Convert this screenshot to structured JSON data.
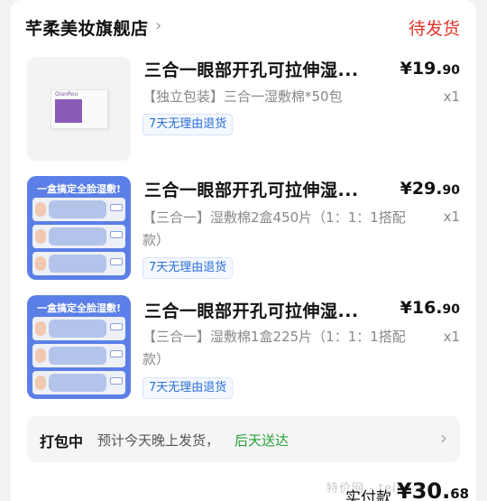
{
  "header": {
    "shop_name": "芊柔美妆旗舰店",
    "chevron": "›",
    "status": "待发货"
  },
  "items": [
    {
      "title": "三合一眼部开孔可拉伸湿...",
      "price_main": "¥19.",
      "price_cents": "90",
      "sku": "【独立包装】三合一湿敷棉*50包",
      "qty": "x1",
      "return_tag": "7天无理由退货",
      "thumb_brand": "QianRou"
    },
    {
      "title": "三合一眼部开孔可拉伸湿...",
      "price_main": "¥29.",
      "price_cents": "90",
      "sku": "【三合一】湿敷棉2盒450片（1：1：1搭配款）",
      "qty": "x1",
      "return_tag": "7天无理由退货",
      "thumb_banner": "一盒搞定全脸湿敷!"
    },
    {
      "title": "三合一眼部开孔可拉伸湿...",
      "price_main": "¥16.",
      "price_cents": "90",
      "sku": "【三合一】湿敷棉1盒225片（1：1：1搭配款）",
      "qty": "x1",
      "return_tag": "7天无理由退货",
      "thumb_banner": "一盒搞定全脸湿敷!"
    }
  ],
  "shipping": {
    "status": "打包中",
    "eta": "预计今天晚上发货，",
    "arrival": "后天送达",
    "chevron": "›"
  },
  "footer": {
    "paid_label": "实付款",
    "paid_main": "¥30.",
    "paid_cents": "68",
    "watermark": "特价网 - teijia.de"
  },
  "colors": {
    "status_red": "#e0362b",
    "return_blue": "#2a6fd6",
    "arrival_green": "#27a13a",
    "thumb_blue": "#5b7fe6"
  }
}
